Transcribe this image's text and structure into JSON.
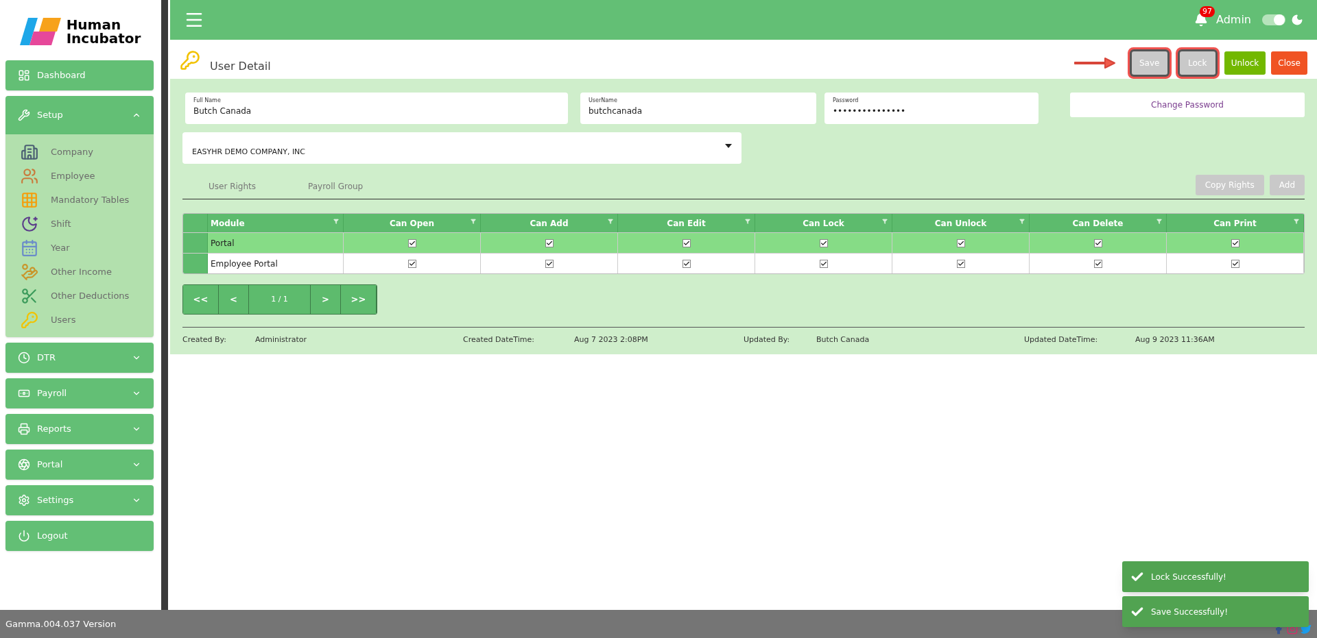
{
  "sidebar": {
    "logo": [
      "Human",
      "Incubator"
    ],
    "items": [
      {
        "label": "Dashboard",
        "kind": "link"
      },
      {
        "label": "Setup",
        "kind": "group",
        "expanded": true,
        "children": [
          {
            "label": "Company"
          },
          {
            "label": "Employee"
          },
          {
            "label": "Mandatory Tables"
          },
          {
            "label": "Shift"
          },
          {
            "label": "Year"
          },
          {
            "label": "Other Income"
          },
          {
            "label": "Other Deductions"
          },
          {
            "label": "Users"
          }
        ]
      },
      {
        "label": "DTR",
        "kind": "group",
        "expanded": false
      },
      {
        "label": "Payroll",
        "kind": "group",
        "expanded": false
      },
      {
        "label": "Reports",
        "kind": "group",
        "expanded": false
      },
      {
        "label": "Portal",
        "kind": "group",
        "expanded": false
      },
      {
        "label": "Settings",
        "kind": "group",
        "expanded": false
      },
      {
        "label": "Logout",
        "kind": "link"
      }
    ]
  },
  "header": {
    "notifications": "97",
    "user": "Admin",
    "dark_mode": {
      "on": true
    }
  },
  "page": {
    "title": "User Detail",
    "buttons": [
      {
        "label": "Save",
        "kind": "save",
        "disabled": true,
        "highlighted": true
      },
      {
        "label": "Lock",
        "kind": "lock",
        "disabled": true,
        "highlighted": true
      },
      {
        "label": "Unlock",
        "kind": "unlock",
        "disabled": false,
        "highlighted": false
      },
      {
        "label": "Close",
        "kind": "close",
        "disabled": false,
        "highlighted": false
      }
    ],
    "fields": [
      {
        "label": "Full Name",
        "value": "Butch Canada"
      },
      {
        "label": "UserName",
        "value": "butchcanada"
      },
      {
        "label": "Password",
        "value": "•••••••••••••••"
      }
    ],
    "change_password": "Change Password",
    "company": "EASYHR DEMO COMPANY, INC",
    "tabs": [
      {
        "label": "User Rights",
        "selected": false
      },
      {
        "label": "Payroll Group",
        "selected": false
      }
    ],
    "actions": [
      {
        "label": "Copy Rights",
        "disabled": true
      },
      {
        "label": "Add",
        "disabled": true
      }
    ],
    "table": {
      "columns": [
        "Module",
        "Can Open",
        "Can Add",
        "Can Edit",
        "Can Lock",
        "Can Unlock",
        "Can Delete",
        "Can Print"
      ],
      "rows": [
        {
          "module": "Portal",
          "selected": true,
          "checks": [
            true,
            true,
            true,
            true,
            true,
            true,
            true
          ]
        },
        {
          "module": "Employee Portal",
          "selected": false,
          "checks": [
            true,
            true,
            true,
            true,
            true,
            true,
            true
          ]
        }
      ]
    },
    "pager": {
      "first": "<<",
      "prev": "<",
      "page": "1 / 1",
      "next": ">",
      "last": ">>"
    },
    "audit": [
      {
        "label": "Created By:",
        "value": "Administrator"
      },
      {
        "label": "Created DateTime:",
        "value": "Aug 7 2023 2:08PM"
      },
      {
        "label": "Updated By:",
        "value": "Butch Canada"
      },
      {
        "label": "Updated DateTime:",
        "value": "Aug 9 2023 11:36AM"
      }
    ]
  },
  "toasts": [
    "Lock Successfully!",
    "Save Successfully!"
  ],
  "footer": {
    "version": "Gamma.004.037 Version"
  }
}
